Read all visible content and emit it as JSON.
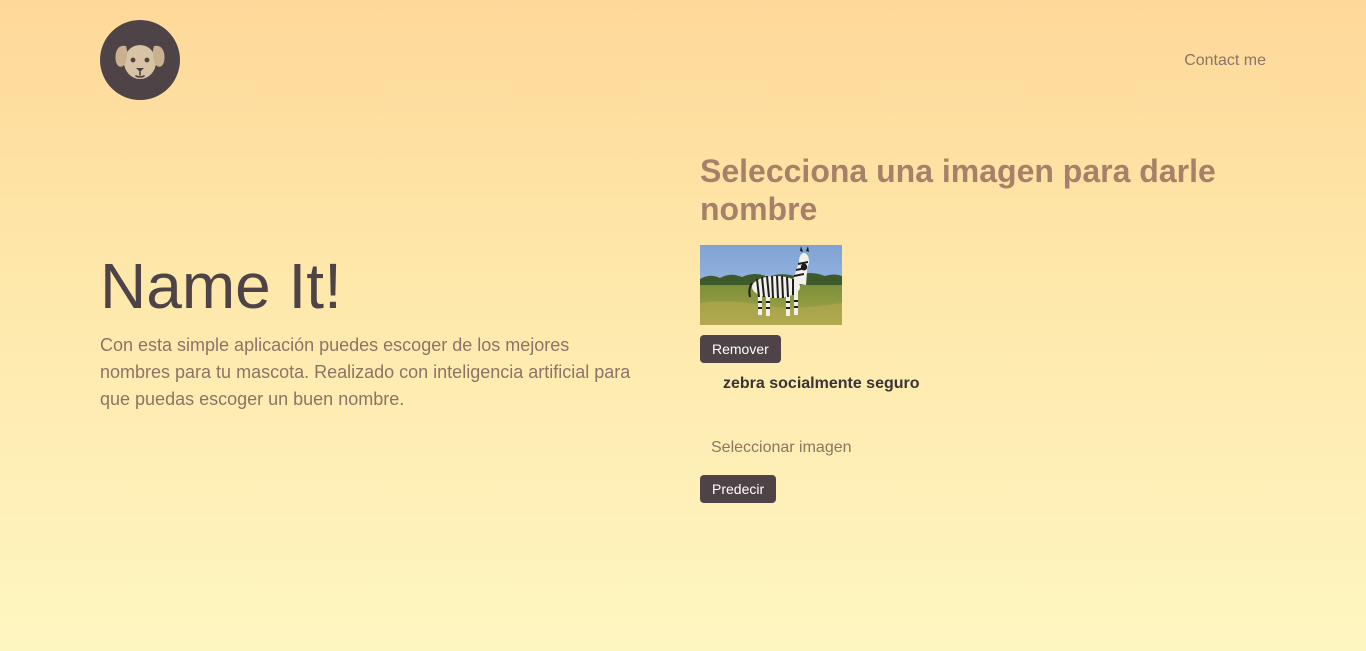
{
  "header": {
    "logo_icon": "dog-face-icon",
    "contact_label": "Contact me"
  },
  "hero": {
    "title": "Name It!",
    "description": "Con esta simple aplicación puedes escoger de los mejores nombres para tu mascota. Realizado con inteligencia artificial para que puedas escoger un buen nombre."
  },
  "panel": {
    "heading": "Selecciona una imagen para darle nombre",
    "preview_image": "zebra-photo",
    "remove_label": "Remover",
    "prediction_text": "zebra socialmente seguro",
    "file_input_label": "Seleccionar imagen",
    "predict_label": "Predecir"
  },
  "colors": {
    "accent_dark": "#4e4346",
    "text_muted": "#8b7466",
    "heading": "#a87f68"
  }
}
